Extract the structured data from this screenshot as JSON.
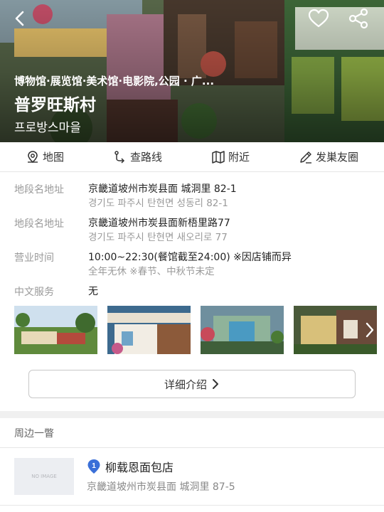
{
  "hero": {
    "categories": "博物馆·展览馆·美术馆·电影院,公园 · 广...",
    "title": "普罗旺斯村",
    "subtitle": "프로방스마을",
    "icons": [
      "back-arrow-icon",
      "heart-icon",
      "share-icon"
    ]
  },
  "actions": [
    {
      "label": "地图",
      "icon": "map-pin-icon"
    },
    {
      "label": "查路线",
      "icon": "route-icon"
    },
    {
      "label": "附近",
      "icon": "map-icon"
    },
    {
      "label": "发巣友圈",
      "icon": "pencil-icon"
    }
  ],
  "info": {
    "rows": [
      {
        "label": "地段名地址",
        "value": "京畿道坡州市炭县面 城洞里 82-1",
        "sub": "경기도 파주시 탄현면 성동리 82-1"
      },
      {
        "label": "地段名地址",
        "value": "京畿道坡州市炭县面新梧里路77",
        "sub": "경기도 파주시 탄현면 새오리로 77"
      },
      {
        "label": "营业时间",
        "value": "10:00~22:30(餐馆截至24:00) ※因店铺而异",
        "sub": "全年无休 ※春节、中秋节未定"
      },
      {
        "label": "中文服务",
        "value": "无",
        "sub": ""
      }
    ]
  },
  "detail_button": "详细介绍",
  "nearby": {
    "heading": "周边一瞥",
    "items": [
      {
        "number": "1",
        "name": "柳载恩面包店",
        "address": "京畿道坡州市炭县面 城洞里 87-5",
        "placeholder": "NO IMAGE"
      }
    ]
  },
  "colors": {
    "pin_blue": "#3a6fd8",
    "border": "#e6e6e6",
    "muted": "#9a9a9a"
  }
}
